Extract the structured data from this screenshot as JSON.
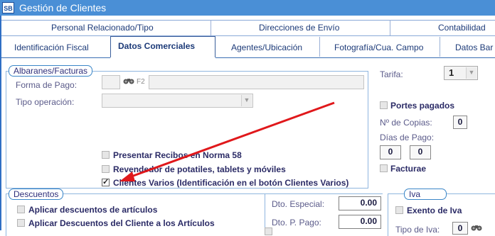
{
  "window": {
    "logo": "SB",
    "title": "Gestión de Clientes"
  },
  "tabs_row1": [
    "Personal Relacionado/Tipo",
    "Direcciones de Envío",
    "Contabilidad"
  ],
  "tabs_row2": [
    "Identificación Fiscal",
    "Datos Comerciales",
    "Agentes/Ubicación",
    "Fotografía/Cua. Campo",
    "Datos Bar"
  ],
  "albaranes": {
    "group_label": "Albaranes/Facturas",
    "forma_pago_label": "Forma de Pago:",
    "f2_label": "F2",
    "tipo_operacion_label": "Tipo operación:",
    "presentar_recibos": "Presentar Recibos en Norma 58",
    "revendedor": "Revendedor de potatiles, tablets y móviles",
    "clientes_varios": "Clientes Varios (Identificación en el botón Clientes Varios)"
  },
  "tarifa": {
    "label": "Tarifa:",
    "value": "1"
  },
  "portes_pagados": "Portes pagados",
  "copias": {
    "label": "Nº de Copias:",
    "value": "0"
  },
  "dias_pago": {
    "label": "Días de Pago:",
    "value1": "0",
    "value2": "0"
  },
  "facturae": "Facturae",
  "descuentos": {
    "group_label": "Descuentos",
    "aplicar_articulos": "Aplicar descuentos de artículos",
    "aplicar_cliente": "Aplicar Descuentos del Cliente a los Artículos",
    "dto_especial_label": "Dto. Especial:",
    "dto_especial_value": "0.00",
    "dto_pago_label": "Dto. P. Pago:",
    "dto_pago_value": "0.00"
  },
  "iva": {
    "group_label": "Iva",
    "exento": "Exento de Iva",
    "tipo_label": "Tipo de Iva:",
    "tipo_value": "0"
  },
  "colors": {
    "accent": "#4a8fd6",
    "arrow": "#e0181b",
    "text": "#2e2e7a"
  }
}
